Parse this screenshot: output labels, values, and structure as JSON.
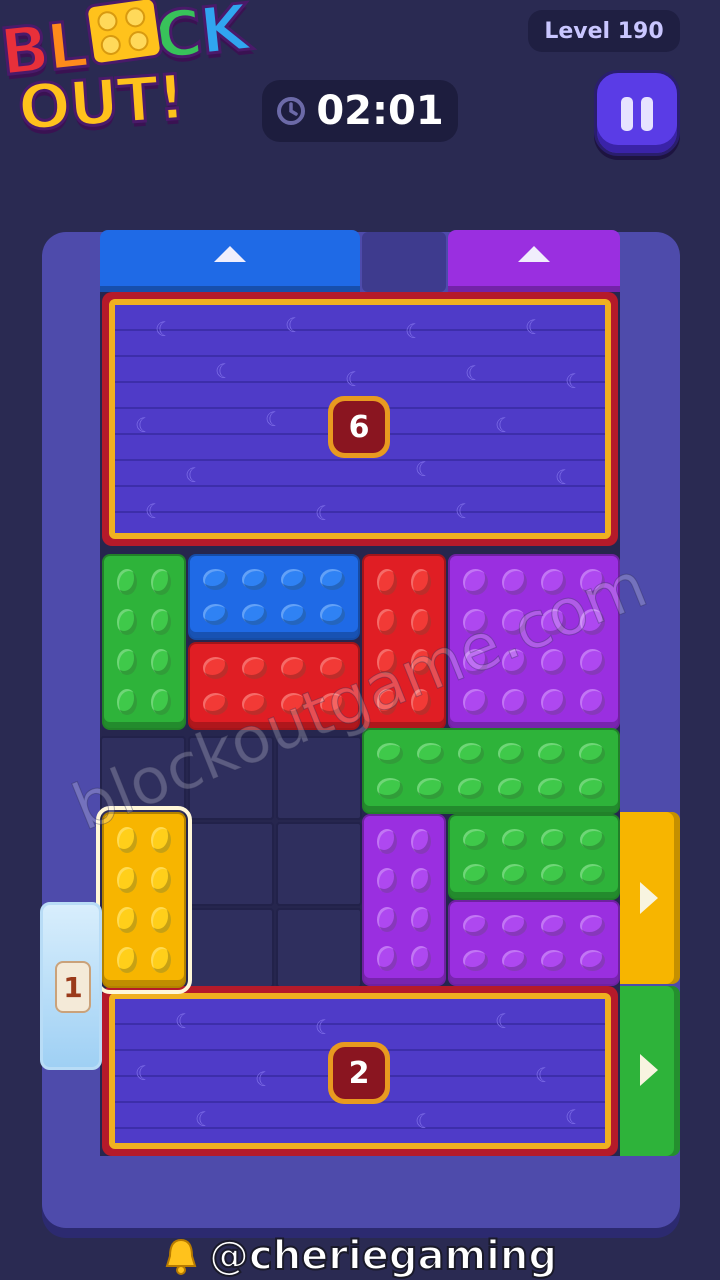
{
  "app": {
    "logo": {
      "line1": [
        "B",
        "L",
        "",
        "C",
        "K"
      ],
      "line2": "OUT!"
    },
    "level": "Level 190",
    "timer": "02:01",
    "pause_icon": "pause-icon",
    "clock_icon": "clock-icon"
  },
  "board": {
    "exits_top": [
      {
        "color": "#1f6ae6",
        "icon": "arrow-up-icon"
      },
      {
        "color": "#9a2fe0",
        "icon": "arrow-up-icon"
      }
    ],
    "exits_right": [
      {
        "color": "#f7b500",
        "icon": "arrow-right-icon"
      },
      {
        "color": "#2eb33a",
        "icon": "arrow-right-icon"
      }
    ],
    "frozen_blocks": [
      {
        "count": "6"
      },
      {
        "count": "2"
      }
    ],
    "ice_block": {
      "count": "1"
    },
    "blocks": [
      {
        "color": "green",
        "studs": "2x4"
      },
      {
        "color": "blue",
        "studs": "4x2"
      },
      {
        "color": "red",
        "studs": "4x2"
      },
      {
        "color": "red",
        "studs": "2x4"
      },
      {
        "color": "purple",
        "studs": "4x4"
      },
      {
        "color": "green",
        "studs": "6x2"
      },
      {
        "color": "yellow",
        "studs": "2x4",
        "selected": true
      },
      {
        "color": "purple",
        "studs": "2x4"
      },
      {
        "color": "green",
        "studs": "4x2"
      },
      {
        "color": "purple",
        "studs": "4x2"
      }
    ]
  },
  "watermark": "blockoutgame.com",
  "credit": {
    "handle": "@cheriegaming",
    "icon": "bell-icon"
  }
}
